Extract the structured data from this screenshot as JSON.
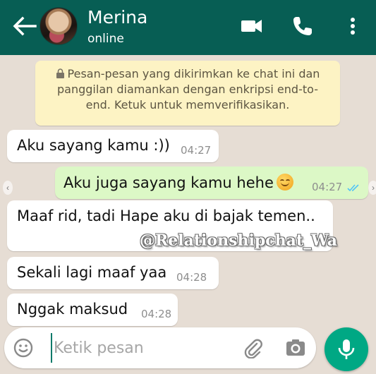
{
  "header": {
    "contact_name": "Merina",
    "status": "online"
  },
  "encryption_notice": {
    "line1": "Pesan-pesan yang dikirimkan ke chat ini dan",
    "line2": "panggilan diamankan dengan enkripsi end-to-",
    "line3": "end. Ketuk untuk memverifikasikan."
  },
  "messages": [
    {
      "direction": "incoming",
      "text": "Aku sayang kamu :))",
      "time": "04:27"
    },
    {
      "direction": "outgoing",
      "text": "Aku juga sayang kamu hehe",
      "emoji": "smiling-face",
      "time": "04:27",
      "read": true
    },
    {
      "direction": "incoming",
      "text": "Maaf rid, tadi Hape aku di bajak temen..",
      "time": ""
    },
    {
      "direction": "incoming",
      "text": "Sekali lagi maaf yaa",
      "time": "04:28"
    },
    {
      "direction": "incoming",
      "text": "Nggak maksud",
      "time": "04:28"
    }
  ],
  "watermark": "@Relationshipchat_Wa",
  "composer": {
    "placeholder": "Ketik pesan"
  },
  "colors": {
    "header": "#075e54",
    "outgoing_bubble": "#dcf8c6",
    "incoming_bubble": "#ffffff",
    "notice_bg": "#fdf3c4",
    "mic_button": "#00a884",
    "read_ticks": "#4fc3f7"
  },
  "icons": [
    "back-arrow-icon",
    "video-call-icon",
    "voice-call-icon",
    "more-menu-icon",
    "lock-icon",
    "emoji-icon",
    "attach-icon",
    "camera-icon",
    "mic-icon",
    "double-check-icon"
  ]
}
